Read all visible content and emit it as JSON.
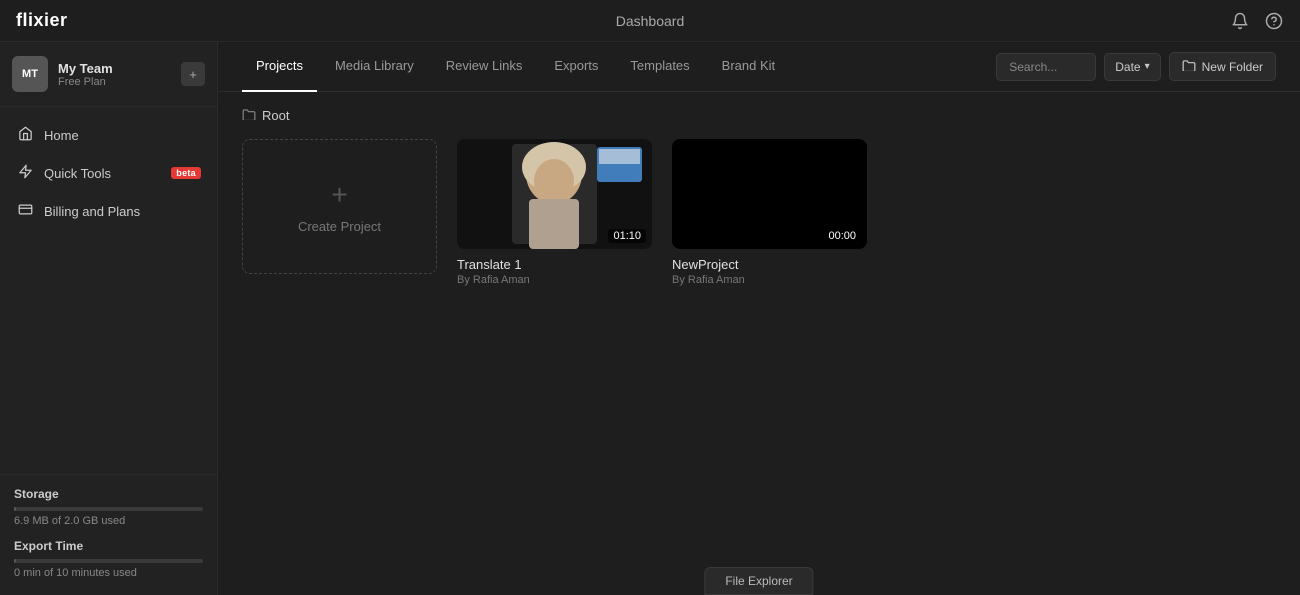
{
  "app": {
    "name": "flixier",
    "topbar_title": "Dashboard"
  },
  "topbar": {
    "logo": "flixier",
    "title": "Dashboard",
    "notification_icon": "🔔",
    "help_icon": "?"
  },
  "sidebar": {
    "team": {
      "avatar_initials": "MT",
      "name": "My Team",
      "plan": "Free Plan",
      "settings_icon": "+"
    },
    "nav": [
      {
        "id": "home",
        "label": "Home",
        "icon": "⌂",
        "active": false
      },
      {
        "id": "quick-tools",
        "label": "Quick Tools",
        "icon": "⚡",
        "active": false,
        "badge": "beta"
      },
      {
        "id": "billing",
        "label": "Billing and Plans",
        "icon": "▤",
        "active": false
      }
    ],
    "storage": {
      "label": "Storage",
      "used": "6.9 MB of 2.0 GB used",
      "fill_percent": 1
    },
    "export_time": {
      "label": "Export Time",
      "used": "0 min of 10 minutes used",
      "fill_percent": 0
    }
  },
  "tabs": [
    {
      "id": "projects",
      "label": "Projects",
      "active": true
    },
    {
      "id": "media-library",
      "label": "Media Library",
      "active": false
    },
    {
      "id": "review-links",
      "label": "Review Links",
      "active": false
    },
    {
      "id": "exports",
      "label": "Exports",
      "active": false
    },
    {
      "id": "templates",
      "label": "Templates",
      "active": false
    },
    {
      "id": "brand-kit",
      "label": "Brand Kit",
      "active": false
    }
  ],
  "toolbar": {
    "search_placeholder": "Search...",
    "date_label": "Date",
    "new_folder_label": "New Folder",
    "folder_icon": "📁"
  },
  "breadcrumb": {
    "icon": "📁",
    "label": "Root"
  },
  "projects": [
    {
      "id": "create",
      "type": "create",
      "label": "Create Project"
    },
    {
      "id": "translate-1",
      "type": "project",
      "name": "Translate 1",
      "author": "By Rafia Aman",
      "duration": "01:10",
      "has_thumb": true
    },
    {
      "id": "new-project",
      "type": "project",
      "name": "NewProject",
      "author": "By Rafia Aman",
      "duration": "00:00",
      "has_thumb": false
    }
  ],
  "file_explorer": {
    "label": "File Explorer"
  }
}
